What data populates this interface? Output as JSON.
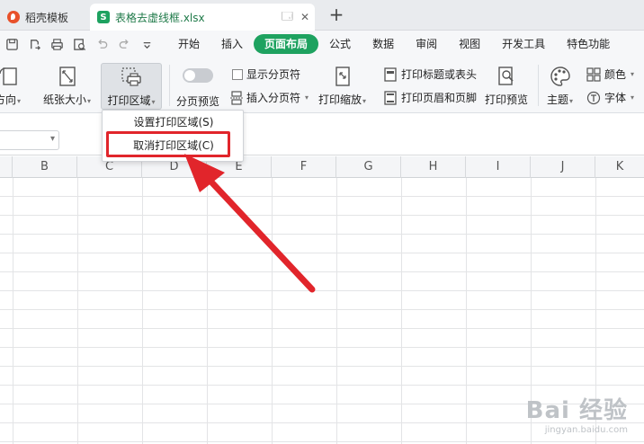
{
  "tabs": {
    "home_label": "稻壳模板",
    "doc_label": "表格去虚线框.xlsx",
    "new_tab": "+"
  },
  "menu": {
    "items": [
      "开始",
      "插入",
      "页面布局",
      "公式",
      "数据",
      "审阅",
      "视图",
      "开发工具",
      "特色功能"
    ],
    "active_index": 2
  },
  "ribbon": {
    "orientation": "方向",
    "paper_size": "纸张大小",
    "print_area": "打印区域",
    "page_preview": "分页预览",
    "show_page_break": "显示分页符",
    "insert_page_break": "插入分页符",
    "print_scale": "打印缩放",
    "print_titles": "打印标题或表头",
    "header_footer": "打印页眉和页脚",
    "print_preview": "打印预览",
    "theme": "主题",
    "colors": "颜色",
    "fonts": "字体"
  },
  "dropdown": {
    "set_print_area": "设置打印区域(S)",
    "cancel_print_area": "取消打印区域(C)"
  },
  "columns": [
    "B",
    "C",
    "D",
    "E",
    "F",
    "G",
    "H",
    "I",
    "J",
    "K"
  ],
  "colors": {
    "accent": "#1ea260",
    "highlight": "#e1252b"
  },
  "watermark": {
    "brand": "Bai 经验",
    "url": "jingyan.baidu.com"
  }
}
